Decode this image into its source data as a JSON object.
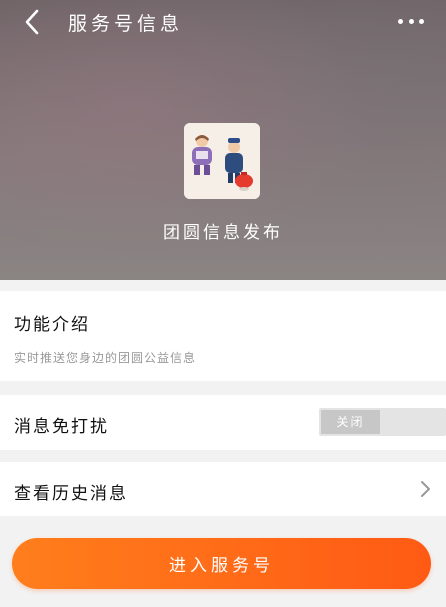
{
  "header": {
    "title": "服务号信息",
    "back_icon": "back-chevron-icon",
    "more_icon": "more-dots-icon"
  },
  "account": {
    "name": "团圆信息发布",
    "avatar_icon": "illustration-avatar"
  },
  "intro": {
    "title": "功能介绍",
    "description": "实时推送您身边的团圆公益信息"
  },
  "do_not_disturb": {
    "label": "消息免打扰",
    "toggle_state_label": "关闭"
  },
  "history": {
    "label": "查看历史消息",
    "arrow_icon": "chevron-right-icon"
  },
  "primary_action": {
    "label": "进入服务号"
  },
  "colors": {
    "accent_start": "#ff7e1c",
    "accent_end": "#ff5a14"
  }
}
